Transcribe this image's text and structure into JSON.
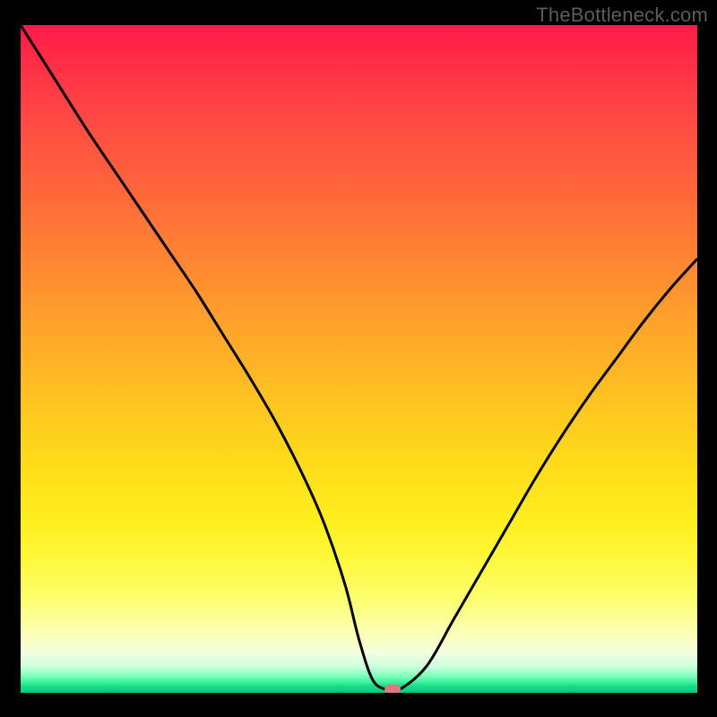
{
  "watermark": "TheBottleneck.com",
  "colors": {
    "curve_stroke": "#000000",
    "marker_fill": "#d97b7e",
    "frame_bg": "#000000"
  },
  "chart_data": {
    "type": "line",
    "title": "",
    "xlabel": "",
    "ylabel": "",
    "xlim": [
      0,
      100
    ],
    "ylim": [
      0,
      100
    ],
    "grid": false,
    "legend": false,
    "series": [
      {
        "name": "bottleneck-curve",
        "x": [
          0,
          5,
          10,
          15,
          18,
          22,
          26,
          30,
          34,
          38,
          42,
          45,
          48,
          50,
          52,
          54,
          56,
          60,
          64,
          68,
          72,
          76,
          80,
          84,
          88,
          92,
          96,
          100
        ],
        "y": [
          100,
          92,
          84,
          76.5,
          72,
          66,
          60,
          53.5,
          47,
          40,
          32,
          25,
          16,
          8,
          2,
          0.5,
          0.5,
          4,
          11,
          18,
          25,
          32,
          38.5,
          44.5,
          50,
          55.5,
          60.5,
          65
        ]
      }
    ],
    "marker": {
      "x": 55,
      "y": 0.5
    },
    "gradient_stops": [
      {
        "pos": 0,
        "color": "#ff1b4a"
      },
      {
        "pos": 20,
        "color": "#ff5440"
      },
      {
        "pos": 40,
        "color": "#ff9a2d"
      },
      {
        "pos": 60,
        "color": "#ffdc1a"
      },
      {
        "pos": 80,
        "color": "#fff93b"
      },
      {
        "pos": 95,
        "color": "#f3ffe0"
      },
      {
        "pos": 100,
        "color": "#09c97c"
      }
    ]
  }
}
